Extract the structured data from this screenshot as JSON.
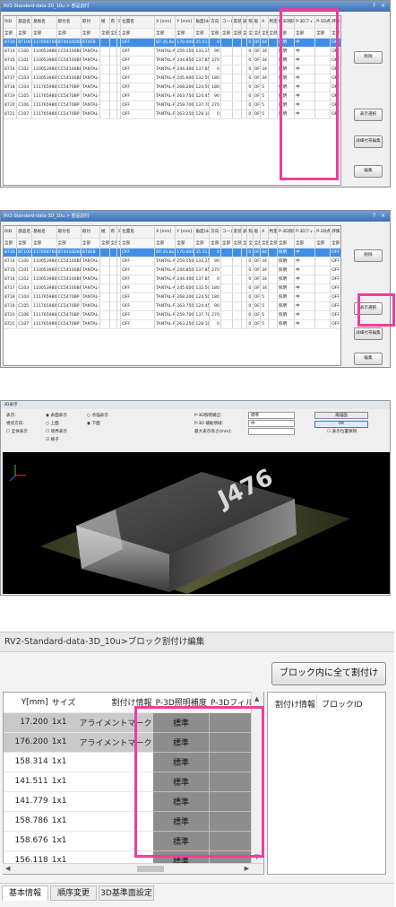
{
  "panel1": {
    "title": "RV2-Standard-data-3D_10u > 部品割付",
    "window_buttons": "? ×",
    "headers": [
      "RID",
      "部品名",
      "基板名",
      "取付名",
      "取付",
      "極",
      "有",
      "S",
      "位置名",
      "X [mm]",
      "Y [mm]",
      "角度[deg]",
      "方向",
      "コード",
      "実装",
      "調整",
      "照",
      "吸",
      "A",
      "判定",
      "P-3D照明",
      "P-3Dフィルタ",
      "P-3D点",
      "評価"
    ],
    "filter_label": "全部",
    "rows": [
      [
        "8710",
        "BT100",
        "1170587601",
        "BT4410D8P",
        "8T4EB",
        "OFF",
        "BT-35.8x21.5-BLK",
        "170.000",
        "35.517",
        "0",
        "",
        "",
        "0",
        "OFF",
        "84",
        "照明",
        "中",
        "OFF"
      ],
      [
        "8714",
        "C100",
        "1100539801",
        "CC54100BP",
        "TANTAL-C",
        "OFF",
        "TANTAL-A",
        "259.150",
        "133.250",
        "90",
        "",
        "",
        "0",
        "OFF",
        "34",
        "照明",
        "中",
        "OFF"
      ],
      [
        "8715",
        "C101",
        "1100539801",
        "CC54100BP",
        "TANTAL-C",
        "OFF",
        "TANTAL-A",
        "244.850",
        "137.850",
        "270",
        "",
        "",
        "0",
        "OFF",
        "34",
        "照明",
        "中",
        "OFF"
      ],
      [
        "8716",
        "C102",
        "1100539801",
        "CC54100BP",
        "TANTAL-C",
        "OFF",
        "TANTAL-A",
        "244.400",
        "137.850",
        "0",
        "",
        "",
        "0",
        "OFF",
        "34",
        "照明",
        "中",
        "OFF"
      ],
      [
        "8717",
        "C103",
        "1100539801",
        "CC54100BP",
        "TANTAL-C",
        "OFF",
        "TANTAL-A",
        "245.600",
        "132.500",
        "180",
        "",
        "",
        "0",
        "OFF",
        "34",
        "照明",
        "中",
        "OFF"
      ],
      [
        "8718",
        "C104",
        "1117659801",
        "CC5470BP",
        "TANTAL-P",
        "OFF",
        "TANTAL-P",
        "268.200",
        "124.500",
        "180",
        "",
        "",
        "0",
        "OFF",
        "5",
        "照明",
        "中",
        "OFF"
      ],
      [
        "8719",
        "C105",
        "1117659801",
        "CC5470BP",
        "TANTAL-P",
        "OFF",
        "TANTAL-P",
        "263.750",
        "124.450",
        "90",
        "",
        "",
        "0",
        "OFF",
        "5",
        "照明",
        "中",
        "OFF"
      ],
      [
        "8720",
        "C106",
        "1117659801",
        "CC5470BP",
        "TANTAL-P",
        "OFF",
        "TANTAL-P",
        "259.700",
        "137.700",
        "270",
        "",
        "",
        "0",
        "OFF",
        "5",
        "照明",
        "中",
        "OFF"
      ],
      [
        "8721",
        "C107",
        "1117659801",
        "CC5470BP",
        "TANTAL-P",
        "OFF",
        "TANTAL-P",
        "263.250",
        "128.100",
        "0",
        "",
        "",
        "0",
        "OFF",
        "5",
        "照明",
        "中",
        "OFF"
      ]
    ],
    "buttons": {
      "b1": "削除",
      "b2": "表示選択",
      "b3": "詳細付帯編集",
      "b4": "編集"
    }
  },
  "panel2": {
    "title": "RV2-Standard-data-3D_10u > 部品割付",
    "window_buttons": "? ×",
    "rows": [
      [
        "8710",
        "BT100",
        "1170587601",
        "BT4410D8P",
        "8T4EB",
        "OFF",
        "BT-35.8x21.5-BLK",
        "170.000",
        "35.517",
        "0",
        "",
        "",
        "0",
        "OFF",
        "84",
        "照明",
        "中",
        "OFF"
      ],
      [
        "8714",
        "C100",
        "1100539801",
        "CC54100BP",
        "TANTAL-C",
        "OFF",
        "TANTAL-A",
        "259.150",
        "133.250",
        "90",
        "",
        "",
        "0",
        "OFF",
        "34",
        "照明",
        "中",
        "OFF"
      ],
      [
        "8715",
        "C101",
        "1100539801",
        "CC54100BP",
        "TANTAL-C",
        "OFF",
        "TANTAL-A",
        "244.850",
        "137.850",
        "270",
        "",
        "",
        "0",
        "OFF",
        "34",
        "照明",
        "中",
        "OFF"
      ],
      [
        "8716",
        "C102",
        "1100539801",
        "CC54100BP",
        "TANTAL-C",
        "OFF",
        "TANTAL-A",
        "244.400",
        "137.850",
        "0",
        "",
        "",
        "0",
        "OFF",
        "34",
        "照明",
        "中",
        "OFF"
      ],
      [
        "8717",
        "C103",
        "1100539801",
        "CC54100BP",
        "TANTAL-C",
        "OFF",
        "TANTAL-A",
        "245.600",
        "132.500",
        "180",
        "",
        "",
        "0",
        "OFF",
        "34",
        "照明",
        "中",
        "OFF"
      ],
      [
        "8718",
        "C104",
        "1117659801",
        "CC5470BP",
        "TANTAL-P",
        "OFF",
        "TANTAL-P",
        "268.200",
        "124.500",
        "180",
        "",
        "",
        "0",
        "OFF",
        "5",
        "照明",
        "中",
        "OFF"
      ],
      [
        "8719",
        "C105",
        "1117659801",
        "CC5470BP",
        "TANTAL-P",
        "OFF",
        "TANTAL-P",
        "263.750",
        "124.450",
        "90",
        "",
        "",
        "0",
        "OFF",
        "5",
        "照明",
        "中",
        "OFF"
      ],
      [
        "8720",
        "C106",
        "1117659801",
        "CC5470BP",
        "TANTAL-P",
        "OFF",
        "TANTAL-P",
        "259.700",
        "137.700",
        "270",
        "",
        "",
        "0",
        "OFF",
        "5",
        "照明",
        "中",
        "OFF"
      ],
      [
        "8721",
        "C107",
        "1117659801",
        "CC5470BP",
        "TANTAL-P",
        "OFF",
        "TANTAL-P",
        "263.250",
        "128.100",
        "0",
        "",
        "",
        "0",
        "OFF",
        "5",
        "照明",
        "中",
        "OFF"
      ]
    ],
    "buttons": {
      "b1": "削除",
      "b2": "表示選択",
      "b3": "詳細付帯編集",
      "b4": "編集"
    }
  },
  "view3d": {
    "title": "3D表示",
    "ctrl_labels": {
      "display": "表示:",
      "surface": "表面表示",
      "dotgrid": "点描表示",
      "point": "視点方向:",
      "up": "上面",
      "down": "下面",
      "fit": "全体表示",
      "border": "境界表示",
      "grid": "格子",
      "p3d_light": "P-3D照明補正:",
      "p3d_filter": "P-3D 補助領域:",
      "height_range": "最大表示高さ[mm]:",
      "light_val": "標準",
      "filter_val": "中",
      "range_val": "",
      "redraw": "再描画",
      "ok": "OK",
      "hold": "表示位置保持"
    },
    "chip_text": "J476"
  },
  "block": {
    "title": "RV2-Standard-data-3D_10u>ブロック割付け編集",
    "assign_all": "ブロック内に全て割付け",
    "headers": {
      "y": "Y[mm]",
      "size": "サイズ",
      "info": "割付け情報",
      "light": "P-3D照明補度",
      "filter": "P-3Dフィルタ"
    },
    "rows": [
      {
        "y": "17.200",
        "size": "1x1",
        "info": "アライメントマーク",
        "light": "標準",
        "filter": "中"
      },
      {
        "y": "176.200",
        "size": "1x1",
        "info": "アライメントマーク",
        "light": "標準",
        "filter": "中"
      },
      {
        "y": "158.314",
        "size": "1x1",
        "info": "",
        "light": "標準",
        "filter": "中"
      },
      {
        "y": "141.511",
        "size": "1x1",
        "info": "",
        "light": "標準",
        "filter": "中"
      },
      {
        "y": "141.779",
        "size": "1x1",
        "info": "",
        "light": "標準",
        "filter": "中"
      },
      {
        "y": "158.786",
        "size": "1x1",
        "info": "",
        "light": "標準",
        "filter": "中"
      },
      {
        "y": "158.676",
        "size": "1x1",
        "info": "",
        "light": "標準",
        "filter": "中"
      },
      {
        "y": "156.118",
        "size": "1x1",
        "info": "",
        "light": "標準",
        "filter": "中"
      }
    ],
    "right_headers": {
      "info": "割付け情報",
      "block_id": "ブロックID"
    },
    "tabs": [
      "基本情報",
      "順序変更",
      "3D基準面設定"
    ]
  },
  "colors": {
    "highlight": "#ee3e9c",
    "selection": "#3f8fe8",
    "cell_gray": "#8d8d8d"
  }
}
